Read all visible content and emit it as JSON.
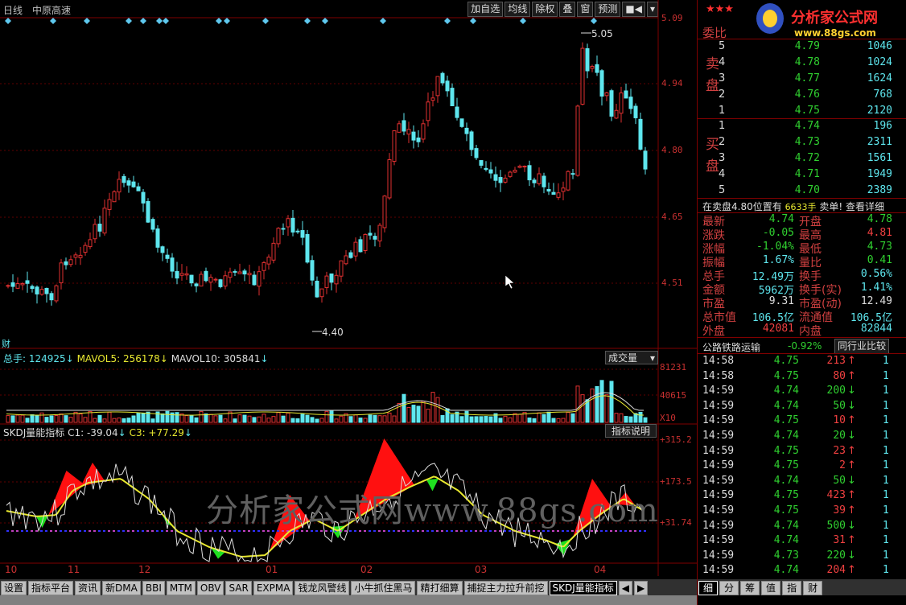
{
  "header": {
    "period": "日线",
    "stock_name": "中原高速",
    "toolbar": [
      "加自选",
      "均线",
      "除权",
      "叠",
      "窗",
      "预测",
      "■◀",
      "▾"
    ]
  },
  "colors": {
    "up": "#e03030",
    "down": "#5ee6ee",
    "axis": "#c83030",
    "ma_yellow": "#e8e830"
  },
  "price_axis": {
    "labels": [
      "5.09",
      "4.94",
      "4.80",
      "4.65",
      "4.51"
    ]
  },
  "price_annotations": {
    "high": "5.05",
    "low": "4.40",
    "cai": "财"
  },
  "volume_panel": {
    "total": "总手: 124925",
    "ma5": "MAVOL5: 256178",
    "ma10": "MAVOL10: 305841",
    "dropdown": "成交量",
    "axis": [
      "81231",
      "40615",
      "X10"
    ]
  },
  "indicator_panel": {
    "name": "SKDJ量能指标",
    "c1": "C1: -39.04",
    "c3": "C3: +77.29",
    "button": "指标说明",
    "axis": [
      "+315.2",
      "+173.5",
      "+31.74"
    ]
  },
  "watermark": "分析家公式网www.88gs.com",
  "x_axis": [
    "10",
    "11",
    "12",
    "01",
    "02",
    "03",
    "04"
  ],
  "bottom_tabs": [
    "设置",
    "指标平台",
    "资讯",
    "新DMA",
    "BBI",
    "MTM",
    "OBV",
    "SAR",
    "EXPMA",
    "钱龙风警线",
    "小牛抓住黑马",
    "精打细算",
    "捕捉主力拉升前挖",
    "SKDJ量能指标"
  ],
  "right_panel": {
    "logo_stars": "★★★",
    "logo_text": "分析家公式网",
    "logo_url": "www.88gs.com",
    "weibi_label": "委比",
    "sell_label": "卖盘",
    "buy_label": "买盘",
    "sell": [
      {
        "idx": "5",
        "price": "4.79",
        "vol": "1046"
      },
      {
        "idx": "4",
        "price": "4.78",
        "vol": "1024"
      },
      {
        "idx": "3",
        "price": "4.77",
        "vol": "1624"
      },
      {
        "idx": "2",
        "price": "4.76",
        "vol": "768"
      },
      {
        "idx": "1",
        "price": "4.75",
        "vol": "2120"
      }
    ],
    "buy": [
      {
        "idx": "1",
        "price": "4.74",
        "vol": "196"
      },
      {
        "idx": "2",
        "price": "4.73",
        "vol": "2311"
      },
      {
        "idx": "3",
        "price": "4.72",
        "vol": "1561"
      },
      {
        "idx": "4",
        "price": "4.71",
        "vol": "1949"
      },
      {
        "idx": "5",
        "price": "4.70",
        "vol": "2389"
      }
    ],
    "notice": "在卖盘4.80位置有",
    "notice_vol": "6633手",
    "notice_action": "卖单! 查看详细",
    "quotes": [
      {
        "k1": "最新",
        "v1": "4.74",
        "c1": "green",
        "k2": "开盘",
        "v2": "4.78",
        "c2": "green"
      },
      {
        "k1": "涨跌",
        "v1": "-0.05",
        "c1": "green",
        "k2": "最高",
        "v2": "4.81",
        "c2": "red"
      },
      {
        "k1": "涨幅",
        "v1": "-1.04%",
        "c1": "green",
        "k2": "最低",
        "v2": "4.73",
        "c2": "green"
      },
      {
        "k1": "振幅",
        "v1": "1.67%",
        "c1": "cyan",
        "k2": "量比",
        "v2": "0.41",
        "c2": "green"
      },
      {
        "k1": "总手",
        "v1": "12.49万",
        "c1": "cyan",
        "k2": "换手",
        "v2": "0.56%",
        "c2": "cyan"
      },
      {
        "k1": "金额",
        "v1": "5962万",
        "c1": "cyan",
        "k2": "换手(实)",
        "v2": "1.41%",
        "c2": "cyan"
      },
      {
        "k1": "市盈",
        "v1": "9.31",
        "c1": "white",
        "k2": "市盈(动)",
        "v2": "12.49",
        "c2": "white"
      },
      {
        "k1": "总市值",
        "v1": "106.5亿",
        "c1": "cyan",
        "k2": "流通值",
        "v2": "106.5亿",
        "c2": "cyan"
      },
      {
        "k1": "外盘",
        "v1": "42081",
        "c1": "red",
        "k2": "内盘",
        "v2": "82844",
        "c2": "cyan"
      }
    ],
    "sector": "公路铁路运输",
    "sector_change": "-0.92%",
    "sector_button": "同行业比较",
    "ticks": [
      {
        "time": "14:58",
        "price": "4.75",
        "vol": "213",
        "dir": "up",
        "n": "1"
      },
      {
        "time": "14:58",
        "price": "4.75",
        "vol": "80",
        "dir": "up",
        "n": "1"
      },
      {
        "time": "14:59",
        "price": "4.74",
        "vol": "200",
        "dir": "down",
        "n": "1"
      },
      {
        "time": "14:59",
        "price": "4.74",
        "vol": "50",
        "dir": "down",
        "n": "1"
      },
      {
        "time": "14:59",
        "price": "4.75",
        "vol": "10",
        "dir": "up",
        "n": "1"
      },
      {
        "time": "14:59",
        "price": "4.74",
        "vol": "20",
        "dir": "down",
        "n": "1"
      },
      {
        "time": "14:59",
        "price": "4.75",
        "vol": "23",
        "dir": "up",
        "n": "1"
      },
      {
        "time": "14:59",
        "price": "4.75",
        "vol": "2",
        "dir": "up",
        "n": "1"
      },
      {
        "time": "14:59",
        "price": "4.74",
        "vol": "50",
        "dir": "down",
        "n": "1"
      },
      {
        "time": "14:59",
        "price": "4.75",
        "vol": "423",
        "dir": "up",
        "n": "1"
      },
      {
        "time": "14:59",
        "price": "4.75",
        "vol": "39",
        "dir": "up",
        "n": "1"
      },
      {
        "time": "14:59",
        "price": "4.74",
        "vol": "500",
        "dir": "down",
        "n": "1"
      },
      {
        "time": "14:59",
        "price": "4.74",
        "vol": "31",
        "dir": "up",
        "n": "1"
      },
      {
        "time": "14:59",
        "price": "4.73",
        "vol": "220",
        "dir": "down",
        "n": "1"
      },
      {
        "time": "14:59",
        "price": "4.74",
        "vol": "204",
        "dir": "up",
        "n": "1"
      }
    ],
    "tabs": [
      "细",
      "分",
      "筹",
      "值",
      "指",
      "财"
    ]
  }
}
